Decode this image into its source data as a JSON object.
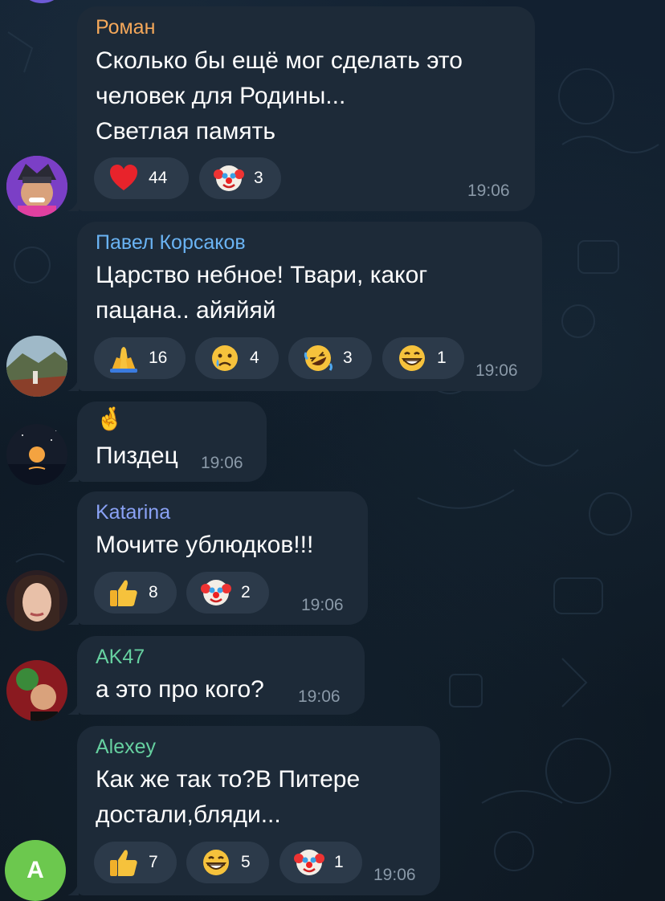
{
  "colors": {
    "background": "#0e1621",
    "bubble": "#1d2a38",
    "reaction_pill": "#2c3a4a",
    "time": "#8a99a8"
  },
  "messages": [
    {
      "sender": "Роман",
      "sender_color": "#f5a85a",
      "lines": [
        "Сколько бы ещё мог сделать это",
        "человек для Родины...",
        "Светлая память"
      ],
      "time": "19:06",
      "avatar": "avatar-roman",
      "reactions": [
        {
          "emoji": "heart-icon",
          "count": "44"
        },
        {
          "emoji": "clown-icon",
          "count": "3"
        }
      ]
    },
    {
      "sender": "Павел Корсаков",
      "sender_color": "#6ab3f3",
      "lines": [
        "Царство небное! Твари, каког",
        "пацана.. айяйяй"
      ],
      "time": "19:06",
      "avatar": "avatar-pavel",
      "reactions": [
        {
          "emoji": "folded-hands-icon",
          "count": "16"
        },
        {
          "emoji": "crying-face-icon",
          "count": "4"
        },
        {
          "emoji": "rolling-laughing-icon",
          "count": "3"
        },
        {
          "emoji": "grinning-face-icon",
          "count": "1"
        }
      ]
    },
    {
      "sender": "",
      "lines": [
        "🤞",
        "Пиздец"
      ],
      "time": "19:06",
      "avatar": "avatar-moon",
      "reactions": []
    },
    {
      "sender": "Katarina",
      "sender_color": "#8aa2f5",
      "lines": [
        "Мочите ублюдков!!!"
      ],
      "time": "19:06",
      "avatar": "avatar-katarina",
      "reactions": [
        {
          "emoji": "thumbs-up-icon",
          "count": "8"
        },
        {
          "emoji": "clown-icon",
          "count": "2"
        }
      ]
    },
    {
      "sender": "AK47",
      "sender_color": "#66d0a0",
      "lines": [
        "а это про кого?"
      ],
      "time": "19:06",
      "avatar": "avatar-ak47",
      "reactions": []
    },
    {
      "sender": "Alexey",
      "sender_color": "#66d0a0",
      "lines": [
        "Как же так то?В Питере",
        "достали,бляди..."
      ],
      "time": "19:06",
      "avatar": "A",
      "avatar_color": "#6cc84e",
      "reactions": [
        {
          "emoji": "thumbs-up-icon",
          "count": "7"
        },
        {
          "emoji": "grinning-face-icon",
          "count": "5"
        },
        {
          "emoji": "clown-icon",
          "count": "1"
        }
      ]
    }
  ]
}
